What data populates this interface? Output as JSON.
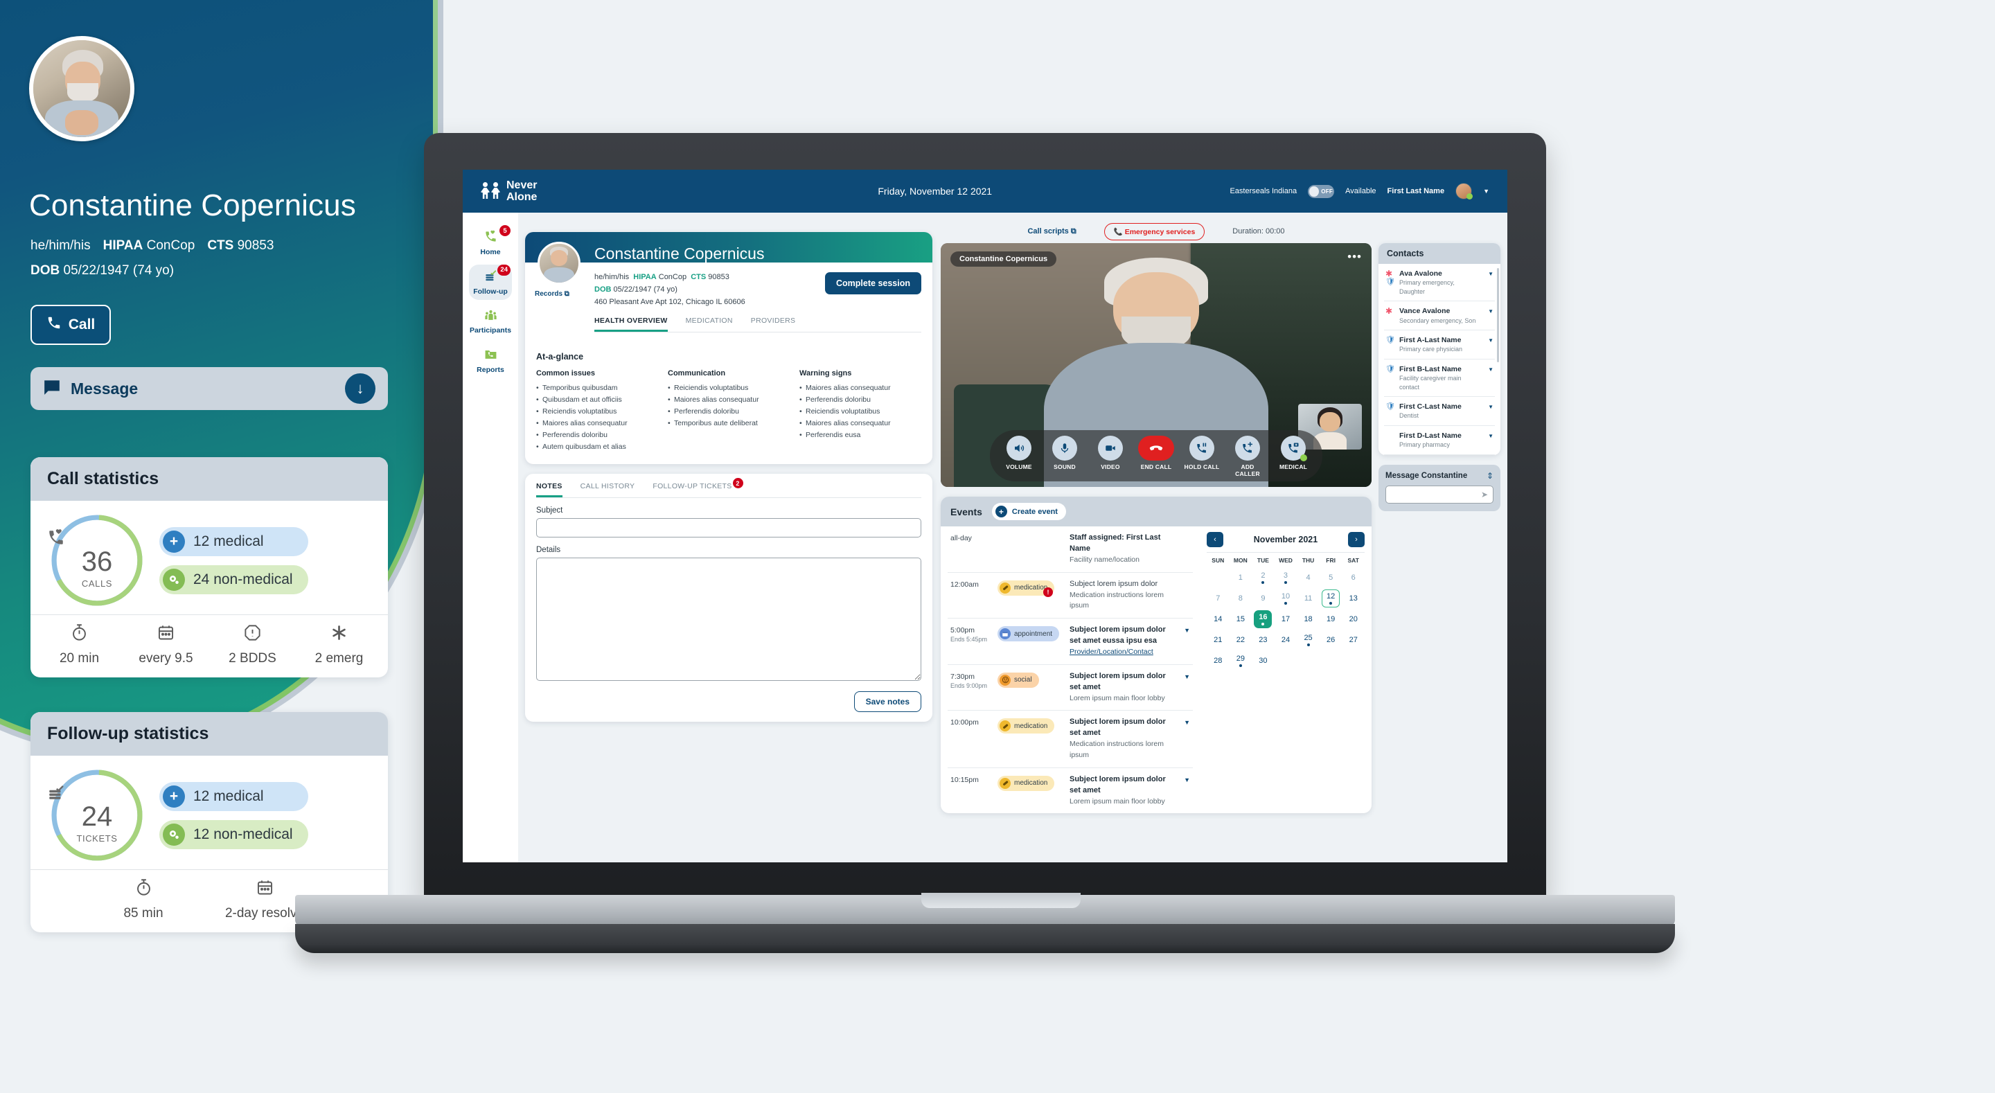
{
  "hero": {
    "name": "Constantine Copernicus",
    "pronouns": "he/him/his",
    "hipaa_label": "HIPAA",
    "hipaa_value": "ConCop",
    "cts_label": "CTS",
    "cts_value": "90853",
    "dob_label": "DOB",
    "dob_value": "05/22/1947 (74 yo)",
    "call_button": "Call",
    "message_button": "Message",
    "phone_icon": "phone-icon",
    "message_icon": "chat-bubble-icon",
    "down_icon": "arrow-down-icon"
  },
  "call_stats": {
    "title": "Call statistics",
    "donut_icon": "phone-heart-icon",
    "number": "36",
    "unit": "CALLS",
    "medical": "12 medical",
    "non_medical": "24 non-medical",
    "footer": [
      {
        "icon": "stopwatch-icon",
        "text": "20 min"
      },
      {
        "icon": "calendar-icon",
        "text": "every 9.5"
      },
      {
        "icon": "alert-octagon-icon",
        "text": "2 BDDS"
      },
      {
        "icon": "asterisk-icon",
        "text": "2 emerg"
      }
    ]
  },
  "followup_stats": {
    "title": "Follow-up statistics",
    "donut_icon": "ticket-check-icon",
    "number": "24",
    "unit": "TICKETS",
    "medical": "12 medical",
    "non_medical": "12 non-medical",
    "footer": [
      {
        "icon": "stopwatch-icon",
        "text": "85 min"
      },
      {
        "icon": "calendar-icon",
        "text": "2-day resolve"
      }
    ]
  },
  "app": {
    "brand_line1": "Never",
    "brand_line2": "Alone",
    "date": "Friday, November 12 2021",
    "org": "Easterseals Indiana",
    "toggle_state": "OFF",
    "availability": "Available",
    "user": "First Last Name",
    "caret": "▼"
  },
  "nav": [
    {
      "label": "Home",
      "icon": "phone-heart-icon",
      "badge": "5",
      "active": false
    },
    {
      "label": "Follow-up",
      "icon": "ticket-check-icon",
      "badge": "24",
      "active": true
    },
    {
      "label": "Participants",
      "icon": "people-icon",
      "badge": "",
      "active": false
    },
    {
      "label": "Reports",
      "icon": "folder-phone-icon",
      "badge": "",
      "active": false
    }
  ],
  "patient": {
    "name": "Constantine Copernicus",
    "records_label": "Records",
    "records_icon": "external-link-icon",
    "pronouns": "he/him/his",
    "hipaa_label": "HIPAA",
    "hipaa_value": "ConCop",
    "cts_label": "CTS",
    "cts_value": "90853",
    "dob_label": "DOB",
    "dob_value": "05/22/1947 (74 yo)",
    "address": "460 Pleasant Ave Apt 102, Chicago IL 60606",
    "complete_session": "Complete session",
    "tabs": [
      {
        "label": "HEALTH OVERVIEW",
        "active": true
      },
      {
        "label": "MEDICATION",
        "active": false
      },
      {
        "label": "PROVIDERS",
        "active": false
      }
    ]
  },
  "glance": {
    "heading": "At-a-glance",
    "columns": [
      {
        "title": "Common issues",
        "items": [
          "Temporibus quibusdam",
          "Quibusdam et aut officiis",
          "Reiciendis voluptatibus",
          "Maiores alias consequatur",
          "Perferendis doloribu",
          "Autem quibusdam et alias"
        ]
      },
      {
        "title": "Communication",
        "items": [
          "Reiciendis voluptatibus",
          "Maiores alias consequatur",
          "Perferendis doloribu",
          "Temporibus aute deliberat"
        ]
      },
      {
        "title": "Warning signs",
        "items": [
          "Maiores alias consequatur",
          "Perferendis doloribu",
          "Reiciendis voluptatibus",
          "Maiores alias consequatur",
          "Perferendis eusa"
        ]
      }
    ]
  },
  "notes": {
    "tabs": [
      {
        "label": "NOTES",
        "active": true,
        "badge": ""
      },
      {
        "label": "CALL HISTORY",
        "active": false,
        "badge": ""
      },
      {
        "label": "FOLLOW-UP TICKETS",
        "active": false,
        "badge": "2"
      }
    ],
    "subject_label": "Subject",
    "subject_value": "",
    "details_label": "Details",
    "details_value": "",
    "save_label": "Save notes"
  },
  "call": {
    "scripts_label": "Call scripts",
    "scripts_icon": "external-link-icon",
    "emergency_label": "Emergency services",
    "emergency_icon": "phone-icon",
    "duration": "Duration: 00:00",
    "video_name": "Constantine Copernicus",
    "more_icon": "ellipsis-icon",
    "controls": [
      {
        "label": "VOLUME",
        "icon": "speaker-icon",
        "type": "normal"
      },
      {
        "label": "SOUND",
        "icon": "microphone-icon",
        "type": "normal"
      },
      {
        "label": "VIDEO",
        "icon": "video-camera-icon",
        "type": "normal"
      },
      {
        "label": "END CALL",
        "icon": "phone-hangup-icon",
        "type": "end"
      },
      {
        "label": "HOLD CALL",
        "icon": "phone-pause-icon",
        "type": "normal"
      },
      {
        "label": "ADD CALLER",
        "icon": "phone-add-icon",
        "type": "normal"
      },
      {
        "label": "MEDICAL",
        "icon": "phone-medical-icon",
        "type": "status"
      }
    ]
  },
  "events": {
    "title": "Events",
    "create_label": "Create event",
    "create_icon": "plus-circle-icon",
    "rows": [
      {
        "time": "all-day",
        "time_sub": "",
        "tag": "",
        "tag_type": "",
        "tag_icon": "",
        "alert": false,
        "avatar": true,
        "title": "Staff assigned: First Last Name",
        "title_bold": true,
        "sub": "Facility name/location",
        "sub_link": false,
        "caret": false
      },
      {
        "time": "12:00am",
        "time_sub": "",
        "tag": "medication",
        "tag_type": "medication",
        "tag_icon": "pill-icon",
        "alert": true,
        "avatar": false,
        "title": "Subject lorem ipsum dolor",
        "title_bold": false,
        "sub": "Medication instructions lorem ipsum",
        "sub_link": false,
        "caret": false
      },
      {
        "time": "5:00pm",
        "time_sub": "Ends 5:45pm",
        "tag": "appointment",
        "tag_type": "appointment",
        "tag_icon": "calendar-icon",
        "alert": false,
        "avatar": false,
        "title": "Subject lorem ipsum dolor set amet eussa ipsu esa",
        "title_bold": true,
        "sub": "Provider/Location/Contact",
        "sub_link": true,
        "caret": true
      },
      {
        "time": "7:30pm",
        "time_sub": "Ends 9:00pm",
        "tag": "social",
        "tag_type": "social",
        "tag_icon": "smiley-icon",
        "alert": false,
        "avatar": false,
        "title": "Subject lorem ipsum dolor set amet",
        "title_bold": true,
        "sub": "Lorem ipsum main floor lobby",
        "sub_link": false,
        "caret": true
      },
      {
        "time": "10:00pm",
        "time_sub": "",
        "tag": "medication",
        "tag_type": "medication",
        "tag_icon": "pill-icon",
        "alert": false,
        "avatar": false,
        "title": "Subject lorem ipsum dolor set amet",
        "title_bold": true,
        "sub": "Medication instructions lorem ipsum",
        "sub_link": false,
        "caret": true
      },
      {
        "time": "10:15pm",
        "time_sub": "",
        "tag": "medication",
        "tag_type": "medication",
        "tag_icon": "pill-icon",
        "alert": false,
        "avatar": false,
        "title": "Subject lorem ipsum dolor set amet",
        "title_bold": true,
        "sub": "Lorem ipsum main floor lobby",
        "sub_link": false,
        "caret": true
      }
    ]
  },
  "calendar": {
    "title": "November 2021",
    "prev_icon": "chevron-left-icon",
    "next_icon": "chevron-right-icon",
    "dow": [
      "SUN",
      "MON",
      "TUE",
      "WED",
      "THU",
      "FRI",
      "SAT"
    ],
    "cells": [
      {
        "n": "",
        "muted": true,
        "dot": false,
        "state": ""
      },
      {
        "n": "1",
        "muted": true,
        "dot": false,
        "state": ""
      },
      {
        "n": "2",
        "muted": true,
        "dot": true,
        "state": ""
      },
      {
        "n": "3",
        "muted": true,
        "dot": true,
        "state": ""
      },
      {
        "n": "4",
        "muted": true,
        "dot": false,
        "state": ""
      },
      {
        "n": "5",
        "muted": true,
        "dot": false,
        "state": ""
      },
      {
        "n": "6",
        "muted": true,
        "dot": false,
        "state": ""
      },
      {
        "n": "7",
        "muted": true,
        "dot": false,
        "state": ""
      },
      {
        "n": "8",
        "muted": true,
        "dot": false,
        "state": ""
      },
      {
        "n": "9",
        "muted": true,
        "dot": false,
        "state": ""
      },
      {
        "n": "10",
        "muted": true,
        "dot": true,
        "state": ""
      },
      {
        "n": "11",
        "muted": true,
        "dot": false,
        "state": ""
      },
      {
        "n": "12",
        "muted": false,
        "dot": true,
        "state": "today"
      },
      {
        "n": "13",
        "muted": false,
        "dot": false,
        "state": ""
      },
      {
        "n": "14",
        "muted": false,
        "dot": false,
        "state": ""
      },
      {
        "n": "15",
        "muted": false,
        "dot": false,
        "state": ""
      },
      {
        "n": "16",
        "muted": false,
        "dot": true,
        "state": "sel"
      },
      {
        "n": "17",
        "muted": false,
        "dot": false,
        "state": ""
      },
      {
        "n": "18",
        "muted": false,
        "dot": false,
        "state": ""
      },
      {
        "n": "19",
        "muted": false,
        "dot": false,
        "state": ""
      },
      {
        "n": "20",
        "muted": false,
        "dot": false,
        "state": ""
      },
      {
        "n": "21",
        "muted": false,
        "dot": false,
        "state": ""
      },
      {
        "n": "22",
        "muted": false,
        "dot": false,
        "state": ""
      },
      {
        "n": "23",
        "muted": false,
        "dot": false,
        "state": ""
      },
      {
        "n": "24",
        "muted": false,
        "dot": false,
        "state": ""
      },
      {
        "n": "25",
        "muted": false,
        "dot": true,
        "state": ""
      },
      {
        "n": "26",
        "muted": false,
        "dot": false,
        "state": ""
      },
      {
        "n": "27",
        "muted": false,
        "dot": false,
        "state": ""
      },
      {
        "n": "28",
        "muted": false,
        "dot": false,
        "state": ""
      },
      {
        "n": "29",
        "muted": false,
        "dot": true,
        "state": ""
      },
      {
        "n": "30",
        "muted": false,
        "dot": false,
        "state": ""
      },
      {
        "n": "",
        "muted": true,
        "dot": false,
        "state": ""
      },
      {
        "n": "",
        "muted": true,
        "dot": false,
        "state": ""
      },
      {
        "n": "",
        "muted": true,
        "dot": false,
        "state": ""
      },
      {
        "n": "",
        "muted": true,
        "dot": false,
        "state": ""
      }
    ]
  },
  "contacts": {
    "title": "Contacts",
    "rows": [
      {
        "name": "Ava Avalone",
        "role": "Primary emergency, Daughter",
        "star": true,
        "shield": true
      },
      {
        "name": "Vance Avalone",
        "role": "Secondary emergency, Son",
        "star": true,
        "shield": false
      },
      {
        "name": "First A-Last Name",
        "role": "Primary care physician",
        "star": false,
        "shield": true
      },
      {
        "name": "First B-Last Name",
        "role": "Facility caregiver main contact",
        "star": false,
        "shield": true
      },
      {
        "name": "First C-Last Name",
        "role": "Dentist",
        "star": false,
        "shield": true
      },
      {
        "name": "First D-Last Name",
        "role": "Primary pharmacy",
        "star": false,
        "shield": false
      }
    ]
  },
  "message_panel": {
    "title": "Message Constantine",
    "expand_icon": "expand-vertical-icon",
    "value": "",
    "send_icon": "send-icon"
  },
  "colors": {
    "brand_blue": "#0d4a77",
    "teal": "#18a085",
    "green": "#8cc152",
    "red": "#d0021b",
    "panel_grey": "#ccd5de"
  }
}
